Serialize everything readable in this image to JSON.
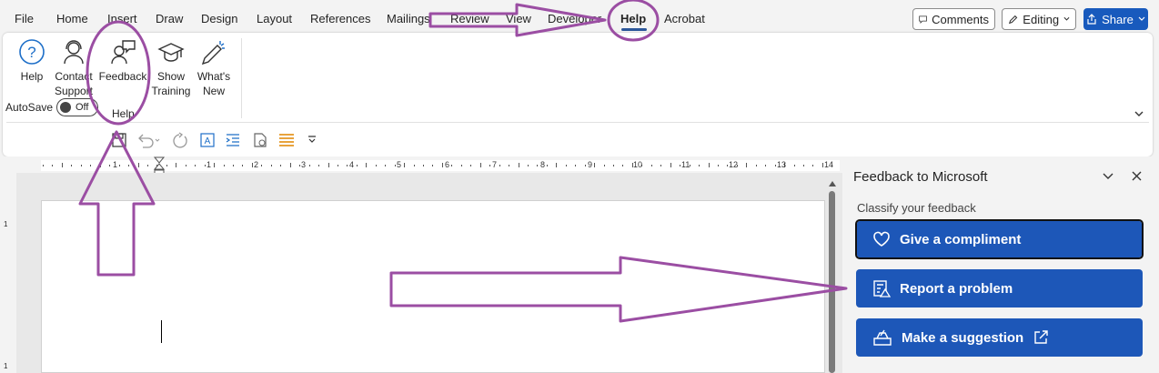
{
  "tabs": [
    "File",
    "Home",
    "Insert",
    "Draw",
    "Design",
    "Layout",
    "References",
    "Mailings",
    "Review",
    "View",
    "Developer",
    "Help",
    "Acrobat"
  ],
  "active_tab": "Help",
  "top_right": {
    "comments": "Comments",
    "editing": "Editing",
    "share": "Share"
  },
  "ribbon": {
    "buttons": [
      {
        "line1": "Help",
        "line2": ""
      },
      {
        "line1": "Contact",
        "line2": "Support"
      },
      {
        "line1": "Feedback",
        "line2": ""
      },
      {
        "line1": "Show",
        "line2": "Training"
      },
      {
        "line1": "What's",
        "line2": "New"
      }
    ],
    "group_label": "Help"
  },
  "qat": {
    "autosave_label": "AutoSave",
    "toggle_state": "Off"
  },
  "ruler_numbers": [
    "1",
    "1",
    "2",
    "3",
    "4",
    "5",
    "6",
    "7",
    "8",
    "9",
    "10",
    "11",
    "12",
    "13",
    "14"
  ],
  "vruler_numbers": [
    "1",
    "1"
  ],
  "feedback_panel": {
    "title": "Feedback to Microsoft",
    "subtitle": "Classify your feedback",
    "buttons": [
      "Give a compliment",
      "Report a problem",
      "Make a suggestion"
    ]
  },
  "colors": {
    "brand_blue": "#185abd",
    "annotation_purple": "#9b4ea3",
    "panel_button": "#1d57b8"
  },
  "icons": [
    "help-icon",
    "contact-support-icon",
    "feedback-icon",
    "show-training-icon",
    "whats-new-icon",
    "heart-icon",
    "report-icon",
    "suggestion-icon",
    "external-link-icon",
    "close-icon",
    "chevron-down-icon"
  ]
}
